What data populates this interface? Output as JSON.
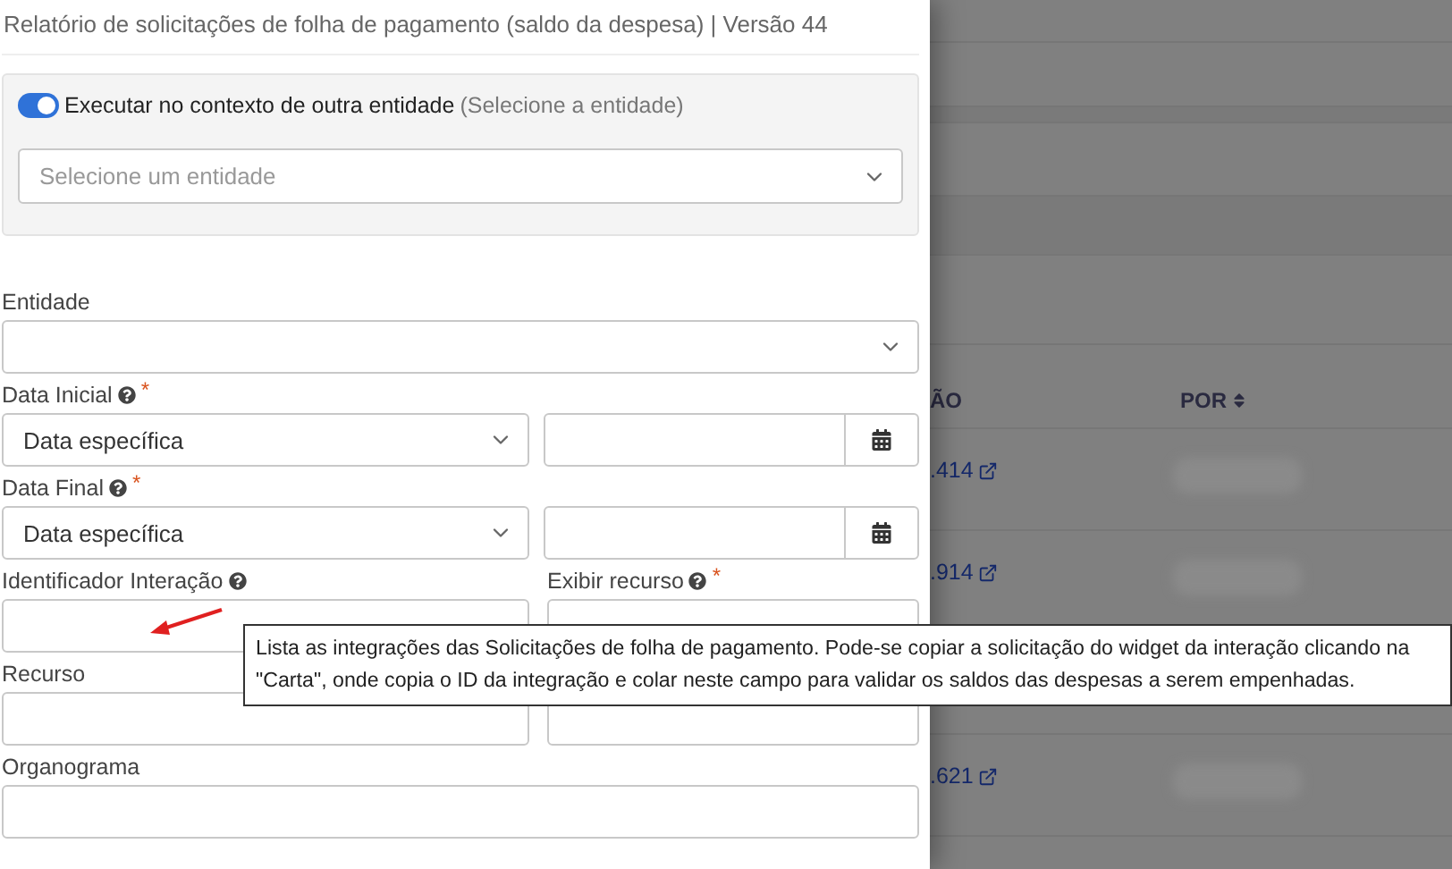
{
  "title": "Relatório de solicitações de folha de pagamento (saldo da despesa) | Versão 44",
  "context": {
    "on": true,
    "label": "Executar no contexto de outra entidade",
    "hint": "(Selecione a entidade)",
    "placeholder": "Selecione um entidade"
  },
  "rows": [
    [
      {
        "label": "Entidade",
        "kind": "select"
      }
    ],
    [
      {
        "label": "Data Inicial",
        "help": true,
        "required_mark": "*",
        "kind": "date-range",
        "value": "Data específica"
      }
    ],
    [
      {
        "label": "Data Final",
        "help": true,
        "required_mark": "*",
        "kind": "date-range",
        "value": "Data específica"
      }
    ],
    [
      {
        "label": "Identificador Interação",
        "help": true,
        "kind": "text"
      },
      {
        "label": "Exibir recurso",
        "help": true,
        "required_mark": "*",
        "kind": "text"
      }
    ],
    [
      {
        "label": "Recurso",
        "kind": "text"
      },
      {
        "kind": "text"
      }
    ],
    [
      {
        "label": "Organograma",
        "kind": "text"
      }
    ]
  ],
  "tooltip": "Lista as integrações das Solicitações de folha de pagamento. Pode-se copiar a solicitação do widget da interação clicando na \"Carta\", onde copia o ID da integração e colar neste campo para validar os saldos das despesas a serem empenhadas.",
  "background_table": {
    "columns": [
      {
        "label": "ÃO",
        "sortable": false
      },
      {
        "label": "POR",
        "sortable": true
      }
    ],
    "rows": [
      {
        "cells": [
          ".414"
        ]
      },
      {
        "cells": [
          ".914"
        ]
      },
      {
        "cells": [
          ".621"
        ]
      }
    ]
  }
}
